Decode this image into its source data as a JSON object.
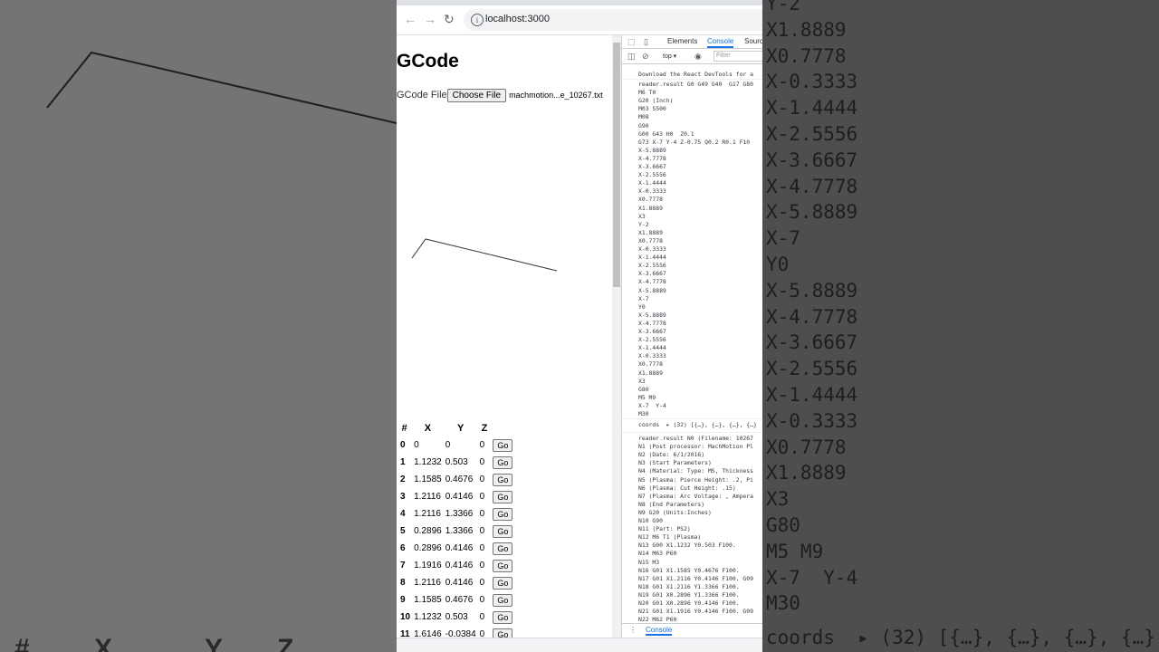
{
  "browser": {
    "url": "localhost:3000"
  },
  "page": {
    "title": "GCode",
    "file_label": "GCode File",
    "choose_file_label": "Choose File",
    "file_name": "machmotion...e_10267.txt",
    "table": {
      "headers": [
        "#",
        "X",
        "Y",
        "Z"
      ],
      "go_label": "Go",
      "rows": [
        {
          "i": "0",
          "x": "0",
          "y": "0",
          "z": "0"
        },
        {
          "i": "1",
          "x": "1.1232",
          "y": "0.503",
          "z": "0"
        },
        {
          "i": "2",
          "x": "1.1585",
          "y": "0.4676",
          "z": "0"
        },
        {
          "i": "3",
          "x": "1.2116",
          "y": "0.4146",
          "z": "0"
        },
        {
          "i": "4",
          "x": "1.2116",
          "y": "1.3366",
          "z": "0"
        },
        {
          "i": "5",
          "x": "0.2896",
          "y": "1.3366",
          "z": "0"
        },
        {
          "i": "6",
          "x": "0.2896",
          "y": "0.4146",
          "z": "0"
        },
        {
          "i": "7",
          "x": "1.1916",
          "y": "0.4146",
          "z": "0"
        },
        {
          "i": "8",
          "x": "1.2116",
          "y": "0.4146",
          "z": "0"
        },
        {
          "i": "9",
          "x": "1.1585",
          "y": "0.4676",
          "z": "0"
        },
        {
          "i": "10",
          "x": "1.1232",
          "y": "0.503",
          "z": "0"
        },
        {
          "i": "11",
          "x": "1.6146",
          "y": "-0.0384",
          "z": "0"
        }
      ]
    }
  },
  "devtools": {
    "tabs": [
      "Elements",
      "Console",
      "Sources"
    ],
    "active_tab": "Console",
    "context": "top",
    "filter_placeholder": "Filter",
    "bottom_tab": "Console",
    "react_msg": "Download the React DevTools for a",
    "block1": [
      "reader.result G0 G49 G40  G17 G80",
      "M6 T0",
      "G20 (Inch)",
      "M03 S500",
      "M08",
      "G90",
      "G00 G43 H0  Z0.1",
      "G73 X-7 Y-4 Z-0.75 Q0.2 R0.1 F10",
      "X-5.8889",
      "X-4.7778",
      "X-3.6667",
      "X-2.5556",
      "X-1.4444",
      "X-0.3333",
      "X0.7778",
      "X1.8889",
      "X3",
      "Y-2",
      "X1.8889",
      "X0.7778",
      "X-0.3333",
      "X-1.4444",
      "X-2.5556",
      "X-3.6667",
      "X-4.7778",
      "X-5.8889",
      "X-7",
      "Y0",
      "X-5.8889",
      "X-4.7778",
      "X-3.6667",
      "X-2.5556",
      "X-1.4444",
      "X-0.3333",
      "X0.7778",
      "X1.8889",
      "X3",
      "G80",
      "M5 M9",
      "X-7  Y-4",
      "M30"
    ],
    "coords_line": "coords  ▸ (32) [{…}, {…}, {…}, {…}",
    "block2": [
      "reader.result N0 (Filename: 10267",
      "N1 (Post processor: MachMotion Pl",
      "N2 (Date: 6/1/2016)",
      "N3 (Start Parameters)",
      "N4 (Material: Type: MS, Thickness",
      "N5 (Plasma: Pierce Height: .2, Pi",
      "N6 (Plasma: Cut Height: .15)",
      "N7 (Plasma: Arc Voltage: , Ampera",
      "N8 (End Parameters)",
      "N9 G20 (Units:Inches)",
      "N10 G90",
      "N11 (Part: PS2)",
      "N12 M6 T1 (Plasma)",
      "N13 G00 X1.1232 Y0.503 F100.",
      "N14 M63 P60",
      "N15 M3",
      "N16 G01 X1.1585 Y0.4676 F100.",
      "N17 G01 X1.2116 Y0.4146 F100. G09",
      "N18 G01 X1.2116 Y1.3366 F100.",
      "N19 G01 X0.2896 Y1.3366 F100.",
      "N20 G01 X0.2896 Y0.4146 F100.",
      "N21 G01 X1.1916 Y0.4146 F100. G09",
      "N22 M62 P60"
    ]
  },
  "background": {
    "left_headers": [
      "#",
      "X",
      "Y",
      "Z"
    ],
    "right_lines": [
      "Y-2",
      "X1.8889",
      "X0.7778",
      "X-0.3333",
      "X-1.4444",
      "X-2.5556",
      "X-3.6667",
      "X-4.7778",
      "X-5.8889",
      "X-7",
      "Y0",
      "X-5.8889",
      "X-4.7778",
      "X-3.6667",
      "X-2.5556",
      "X-1.4444",
      "X-0.3333",
      "X0.7778",
      "X1.8889",
      "X3",
      "G80",
      "M5 M9",
      "X-7  Y-4",
      "M30"
    ],
    "right_coords": "coords  ▸ (32) [{…}, {…}, {…}, {…}"
  }
}
